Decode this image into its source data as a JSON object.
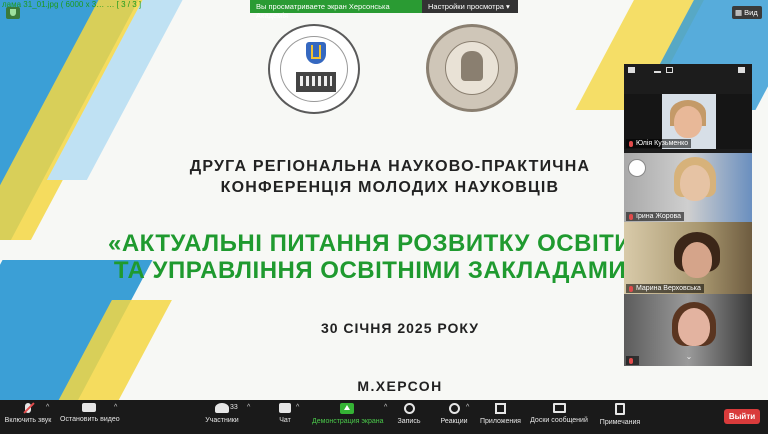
{
  "window": {
    "file_title": "лама 31_01.jpg  ( 6000 x 3…  …  [ 3 / 3 ]"
  },
  "share_banner": {
    "text": "Вы просматриваете экран Херсонська Академія",
    "view_options_label": "Настройки просмотра ▾"
  },
  "view_button": {
    "label": "▦ Вид"
  },
  "slide": {
    "conference_line1": "ДРУГА РЕГІОНАЛЬНА НАУКОВО-ПРАКТИЧНА",
    "conference_line2": "КОНФЕРЕНЦІЯ МОЛОДИХ НАУКОВЦІВ",
    "topic_line1": "«АКТУАЛЬНІ ПИТАННЯ РОЗВИТКУ ОСВІТИ",
    "topic_line2": "ТА УПРАВЛІННЯ ОСВІТНІМИ ЗАКЛАДАМИ",
    "date": "30 СІЧНЯ 2025 РОКУ",
    "city": "М.ХЕРСОН"
  },
  "gallery": {
    "participants": [
      {
        "name": "Юлія Кузьменко"
      },
      {
        "name": "Ірина Жорова"
      },
      {
        "name": "Марина Верховська"
      },
      {
        "name": ""
      }
    ],
    "scroll_down_glyph": "⌄"
  },
  "toolbar": {
    "audio_label": "Включить звук",
    "video_label": "Остановить видео",
    "participants_label": "Участники",
    "participants_count": "33",
    "chat_label": "Чат",
    "share_label": "Демонстрация экрана",
    "record_label": "Запись",
    "reactions_label": "Реакции",
    "apps_label": "Приложения",
    "whiteboards_label": "Доски сообщений",
    "notes_label": "Примечания",
    "leave_label": "Выйти",
    "caret_glyph": "^"
  },
  "colors": {
    "accent_green": "#1f9a2f",
    "share_banner_green": "#2a9b33",
    "leave_red": "#d93b3b",
    "stripe_blue": "#3b9fd6",
    "stripe_yellow": "#f4d743"
  }
}
